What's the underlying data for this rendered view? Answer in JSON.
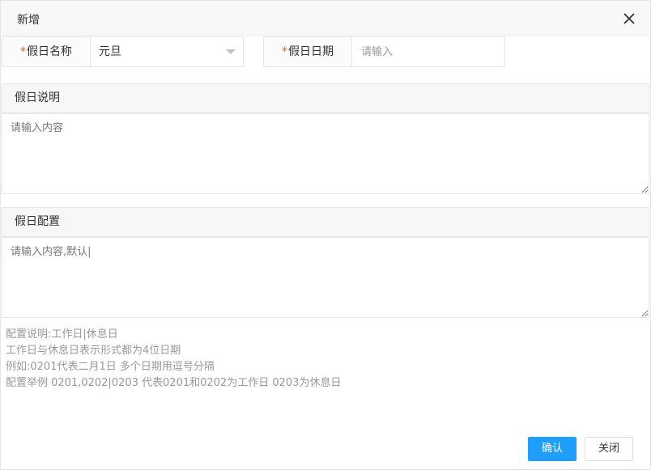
{
  "dialog": {
    "title": "新增",
    "close_icon": "close-icon"
  },
  "form": {
    "required_mark": "*",
    "holiday_name": {
      "label": "假日名称",
      "value": "元旦",
      "dropdown_icon": "chevron-down-icon"
    },
    "holiday_date": {
      "label": "假日日期",
      "placeholder": "请输入"
    },
    "description": {
      "label": "假日说明",
      "placeholder": "请输入内容"
    },
    "config": {
      "label": "假日配置",
      "placeholder": "请输入内容,默认|"
    }
  },
  "notes": [
    "配置说明:工作日|休息日",
    "工作日与休息日表示形式都为4位日期",
    "例如:0201代表二月1日 多个日期用逗号分隔",
    "配置举例 0201,0202|0203 代表0201和0202为工作日 0203为休息日"
  ],
  "buttons": {
    "confirm": "确认",
    "close": "关闭"
  },
  "colors": {
    "primary": "#1e9fff",
    "required": "#ff5722"
  }
}
